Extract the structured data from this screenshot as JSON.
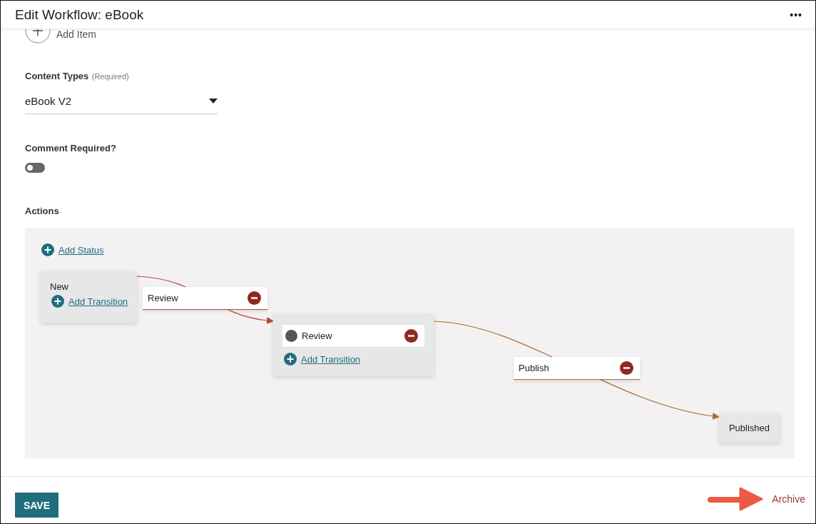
{
  "header": {
    "title": "Edit Workflow: eBook",
    "menu": "•••"
  },
  "add_item": {
    "label": "Add Item"
  },
  "content_types": {
    "label": "Content Types",
    "hint": "(Required)",
    "value": "eBook V2"
  },
  "comment_required": {
    "label": "Comment Required?",
    "on": false
  },
  "actions": {
    "label": "Actions",
    "add_status": "Add Status",
    "statuses": [
      {
        "kind": "start",
        "name": "New",
        "add_transition": "Add Transition"
      },
      {
        "kind": "step",
        "name": "Review",
        "add_transition": "Add Transition"
      },
      {
        "kind": "end",
        "name": "Published"
      }
    ],
    "transitions": [
      {
        "name": "Review",
        "color": "#b5493a"
      },
      {
        "name": "Publish",
        "color": "#a8702a"
      }
    ]
  },
  "footer": {
    "save": "SAVE",
    "archive": "Archive"
  }
}
